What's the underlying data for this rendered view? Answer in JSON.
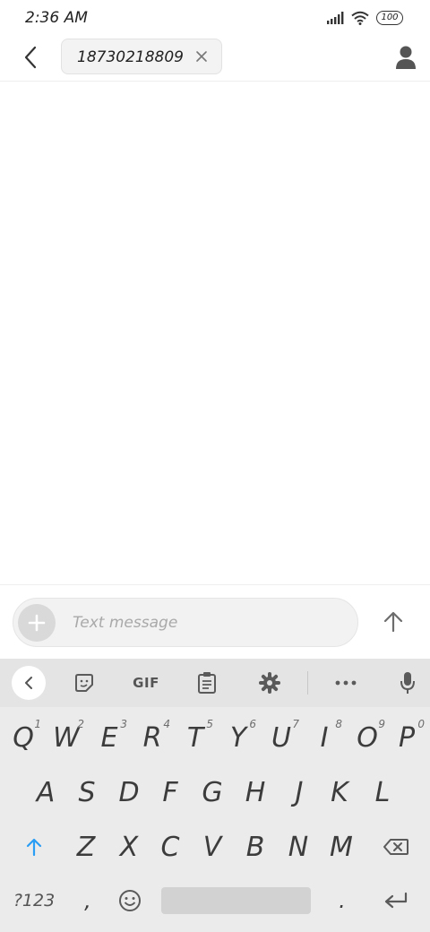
{
  "status_bar": {
    "time": "2:36 AM",
    "battery": "100",
    "icons": [
      "signal-icon",
      "wifi-icon",
      "battery-icon"
    ]
  },
  "header": {
    "recipient": "18730218809",
    "icons": [
      "back-arrow-icon",
      "close-icon",
      "contact-icon"
    ]
  },
  "compose": {
    "placeholder": "Text message",
    "value": "",
    "icons": [
      "plus-icon",
      "send-arrow-icon"
    ]
  },
  "keyboard": {
    "toolbar": {
      "gif_label": "GIF",
      "icons": [
        "chevron-left-icon",
        "sticker-icon",
        "clipboard-icon",
        "gear-icon",
        "more-icon",
        "microphone-icon"
      ]
    },
    "row1": [
      {
        "key": "Q",
        "hint": "1"
      },
      {
        "key": "W",
        "hint": "2"
      },
      {
        "key": "E",
        "hint": "3"
      },
      {
        "key": "R",
        "hint": "4"
      },
      {
        "key": "T",
        "hint": "5"
      },
      {
        "key": "Y",
        "hint": "6"
      },
      {
        "key": "U",
        "hint": "7"
      },
      {
        "key": "I",
        "hint": "8"
      },
      {
        "key": "O",
        "hint": "9"
      },
      {
        "key": "P",
        "hint": "0"
      }
    ],
    "row2": [
      "A",
      "S",
      "D",
      "F",
      "G",
      "H",
      "J",
      "K",
      "L"
    ],
    "row3": [
      "Z",
      "X",
      "C",
      "V",
      "B",
      "N",
      "M"
    ],
    "bottom": {
      "symbols": "?123",
      "comma": ",",
      "period": "."
    },
    "accent_color": "#2a9df4"
  }
}
